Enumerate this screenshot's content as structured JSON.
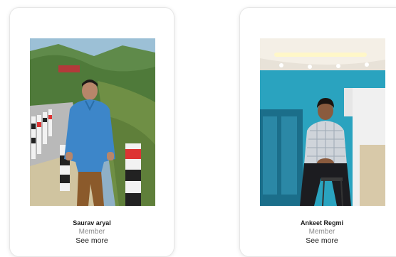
{
  "members": [
    {
      "name": "Saurav aryal",
      "role": "Member",
      "link_label": "See more"
    },
    {
      "name": "Ankeet Regmi",
      "role": "Member",
      "link_label": "See more"
    }
  ],
  "colors": {
    "card_border": "#e6e6e6",
    "name_text": "#1a1a1a",
    "role_text": "#8a8a8a"
  }
}
